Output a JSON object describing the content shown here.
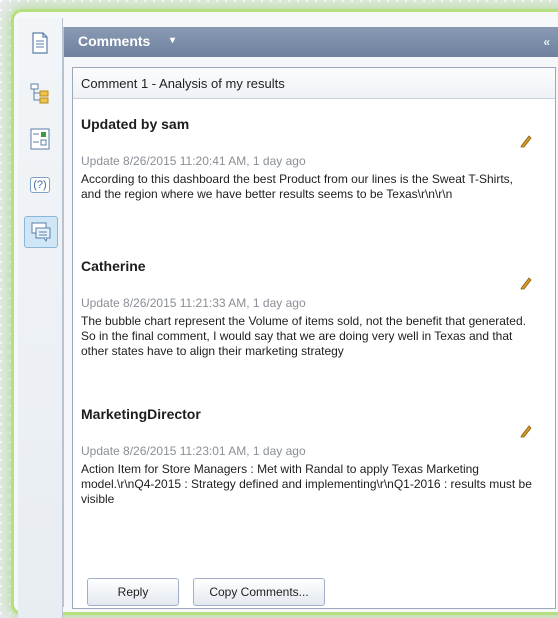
{
  "sidebar": {
    "buttons": [
      {
        "name": "document-icon"
      },
      {
        "name": "hierarchy-icon"
      },
      {
        "name": "checklist-icon"
      },
      {
        "name": "help-icon",
        "glyph": "(?)"
      },
      {
        "name": "comments-icon"
      }
    ]
  },
  "panel": {
    "title": "Comments",
    "caret": "▾",
    "collapse_glyph": "«"
  },
  "card": {
    "title": "Comment 1 - Analysis of my results",
    "comments": [
      {
        "author": "Updated by sam",
        "meta": "Update 8/26/2015 11:20:41 AM, 1 day ago",
        "text": "According to this dashboard the best Product from our lines is the Sweat T-Shirts, and the region where we have better results seems to be Texas\\r\\n\\r\\n"
      },
      {
        "author": "Catherine",
        "meta": "Update 8/26/2015 11:21:33 AM, 1 day ago",
        "text": "The bubble chart represent the Volume of items sold, not the benefit that generated. So in the final comment, I would say that we are doing very well in Texas and that other states have to align their marketing strategy"
      },
      {
        "author": "MarketingDirector",
        "meta": "Update 8/26/2015 11:23:01 AM, 1 day ago",
        "text": "Action Item for Store Managers : Met with Randal to apply Texas Marketing model.\\r\\nQ4-2015 : Strategy defined and implementing\\r\\nQ1-2016 : results must be visible"
      }
    ],
    "reply_label": "Reply",
    "copy_label": "Copy Comments..."
  }
}
